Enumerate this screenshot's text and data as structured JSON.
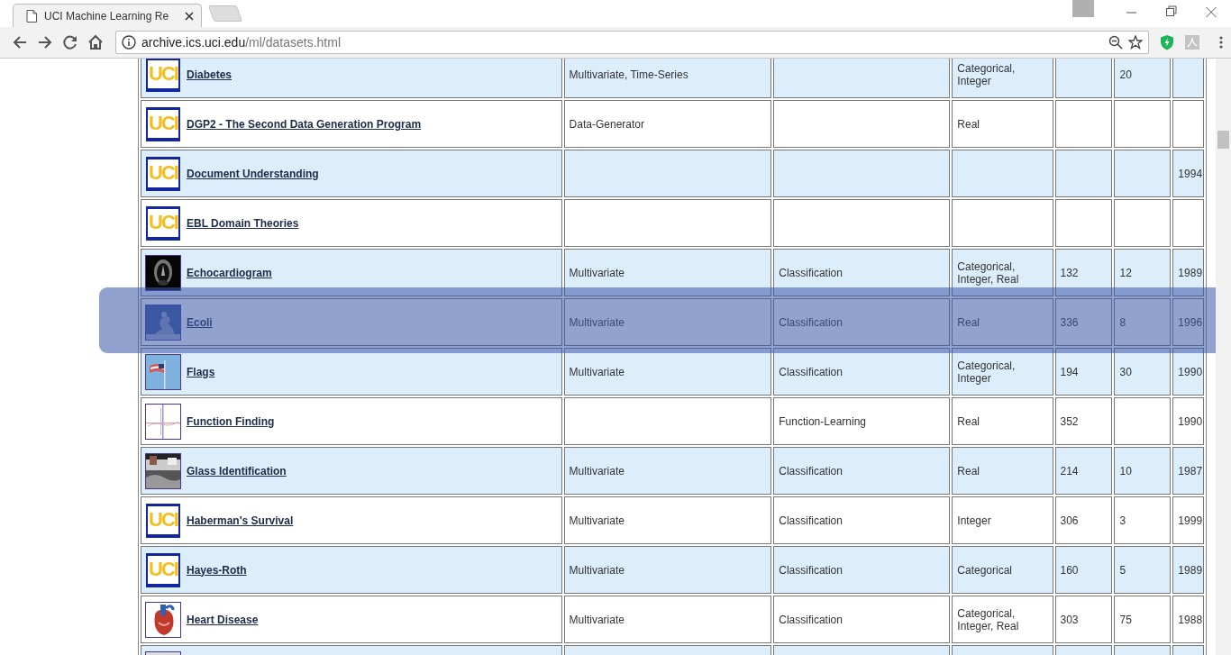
{
  "browser": {
    "tab_title": "UCI Machine Learning Re",
    "url_host": "archive.ics.uci.edu",
    "url_path": "/ml/datasets.html"
  },
  "table": {
    "rows": [
      {
        "thumb": {
          "kind": "logo",
          "text": "UCI"
        },
        "name": "Diabetes",
        "column_2": "Multivariate, Time-Series",
        "column_4": "Categorical, Integer",
        "column_6": "20",
        "selected": false
      },
      {
        "thumb": {
          "kind": "logo",
          "text": "UCI"
        },
        "name": "DGP2 - The Second Data Generation Program",
        "column_2": "Data-Generator",
        "column_4": "Real",
        "selected": false
      },
      {
        "thumb": {
          "kind": "logo",
          "text": "UCI"
        },
        "name": "Document Understanding",
        "column_7": "1994",
        "selected": false
      },
      {
        "thumb": {
          "kind": "logo",
          "text": "UCI"
        },
        "name": "EBL Domain Theories",
        "selected": false
      },
      {
        "name": "Echocardiogram",
        "column_2": "Multivariate",
        "column_3": "Classification",
        "column_4": "Categorical, Integer, Real",
        "column_5": "132",
        "column_6": "12",
        "column_7": "1989",
        "selected": false
      },
      {
        "name": "Ecoli",
        "column_2": "Multivariate",
        "column_3": "Classification",
        "column_4": "Real",
        "column_5": "336",
        "column_6": "8",
        "column_7": "1996",
        "selected": true
      },
      {
        "name": "Flags",
        "column_2": "Multivariate",
        "column_3": "Classification",
        "column_4": "Categorical, Integer",
        "column_5": "194",
        "column_6": "30",
        "column_7": "1990",
        "selected": false
      },
      {
        "name": "Function Finding",
        "column_3": "Function-Learning",
        "column_4": "Real",
        "column_5": "352",
        "column_7": "1990",
        "selected": false
      },
      {
        "name": "Glass Identification",
        "column_2": "Multivariate",
        "column_3": "Classification",
        "column_4": "Real",
        "column_5": "214",
        "column_6": "10",
        "column_7": "1987",
        "selected": false
      },
      {
        "thumb": {
          "kind": "logo",
          "text": "UCI"
        },
        "name": "Haberman's Survival",
        "column_2": "Multivariate",
        "column_3": "Classification",
        "column_4": "Integer",
        "column_5": "306",
        "column_6": "3",
        "column_7": "1999",
        "selected": false
      },
      {
        "thumb": {
          "kind": "logo",
          "text": "UCI"
        },
        "name": "Hayes-Roth",
        "column_2": "Multivariate",
        "column_3": "Classification",
        "column_4": "Categorical",
        "column_5": "160",
        "column_6": "5",
        "column_7": "1989",
        "selected": false
      },
      {
        "name": "Heart Disease",
        "column_2": "Multivariate",
        "column_3": "Classification",
        "column_4": "Categorical, Integer, Real",
        "column_5": "303",
        "column_6": "75",
        "column_7": "1988",
        "selected": false
      },
      {
        "selected": false
      }
    ]
  }
}
